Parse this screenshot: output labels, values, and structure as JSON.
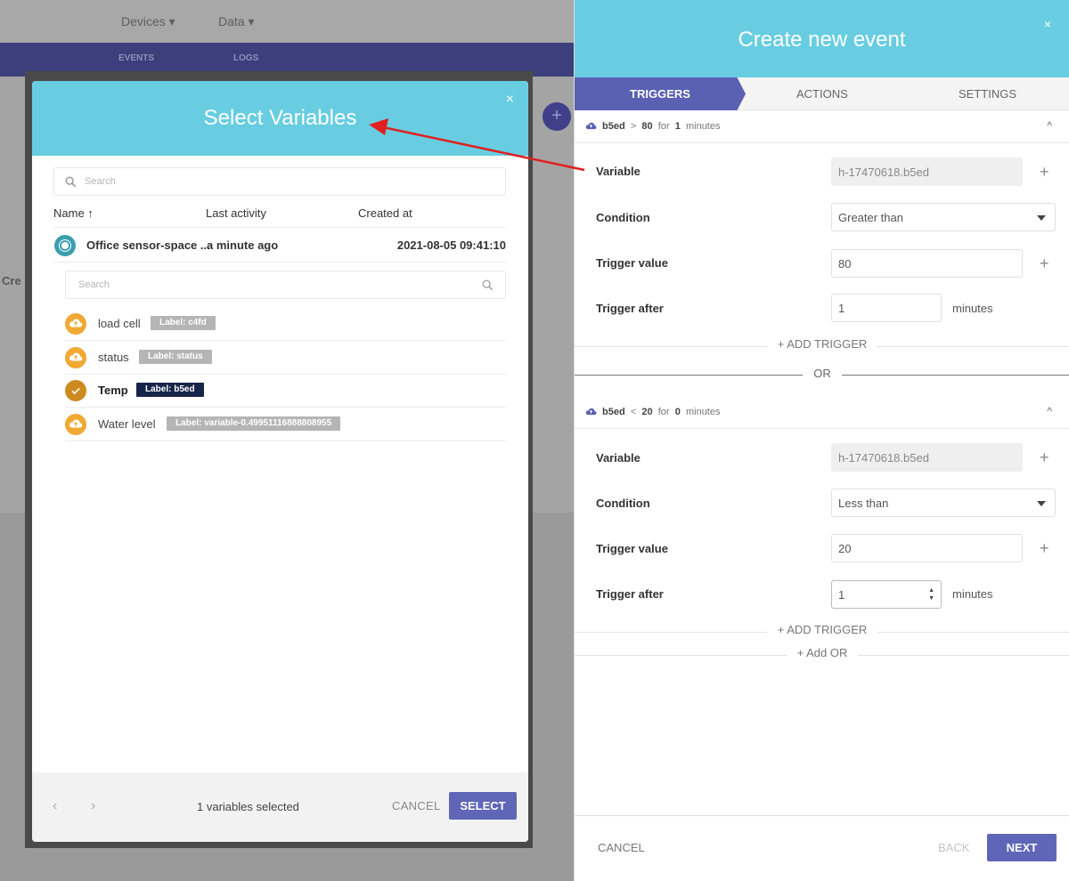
{
  "background": {
    "nav": [
      "Devices",
      "Data"
    ],
    "subnav": [
      "EVENTS",
      "LOGS"
    ],
    "plus_label": "+",
    "partial_heading": "Cre"
  },
  "select_variables": {
    "title": "Select Variables",
    "close": "×",
    "search_placeholder": "Search",
    "columns": {
      "name": "Name ↑",
      "last_activity": "Last activity",
      "created_at": "Created at"
    },
    "device": {
      "name": "Office sensor-space ...",
      "last_activity": "a minute ago",
      "created_at": "2021-08-05 09:41:10"
    },
    "variable_search_placeholder": "Search",
    "variables": [
      {
        "name": "load cell",
        "label": "Label: c4fd",
        "selected": false
      },
      {
        "name": "status",
        "label": "Label: status",
        "selected": false
      },
      {
        "name": "Temp",
        "label": "Label: b5ed",
        "selected": true
      },
      {
        "name": "Water level",
        "label": "Label: variable-0.49951116888808955",
        "selected": false
      }
    ],
    "footer": {
      "prev": "‹",
      "next": "›",
      "selected_count": "1 variables selected",
      "cancel": "CANCEL",
      "select": "SELECT"
    }
  },
  "create_event": {
    "title": "Create new event",
    "close": "×",
    "tabs": [
      "TRIGGERS",
      "ACTIONS",
      "SETTINGS"
    ],
    "triggers": [
      {
        "summary": {
          "var": "b5ed",
          "op": ">",
          "value": "80",
          "for": "for",
          "duration": "1",
          "unit": "minutes"
        },
        "variable_label": "Variable",
        "variable_value": "h-17470618.b5ed",
        "condition_label": "Condition",
        "condition_value": "Greater than",
        "trigger_value_label": "Trigger value",
        "trigger_value": "80",
        "trigger_after_label": "Trigger after",
        "trigger_after": "1",
        "trigger_after_unit": "minutes",
        "add_trigger": "+ ADD TRIGGER"
      },
      {
        "summary": {
          "var": "b5ed",
          "op": "<",
          "value": "20",
          "for": "for",
          "duration": "0",
          "unit": "minutes"
        },
        "variable_label": "Variable",
        "variable_value": "h-17470618.b5ed",
        "condition_label": "Condition",
        "condition_value": "Less than",
        "trigger_value_label": "Trigger value",
        "trigger_value": "20",
        "trigger_after_label": "Trigger after",
        "trigger_after": "1",
        "trigger_after_unit": "minutes",
        "add_trigger": "+ ADD TRIGGER"
      }
    ],
    "or_label": "OR",
    "add_or": "+ Add OR",
    "plus": "+",
    "collapse": "^",
    "footer": {
      "cancel": "CANCEL",
      "back": "BACK",
      "next": "NEXT"
    }
  },
  "colors": {
    "header": "#68cde1",
    "primary": "#5f66b7",
    "arrow": "#e02020",
    "variable_icon": "#f0a933"
  }
}
